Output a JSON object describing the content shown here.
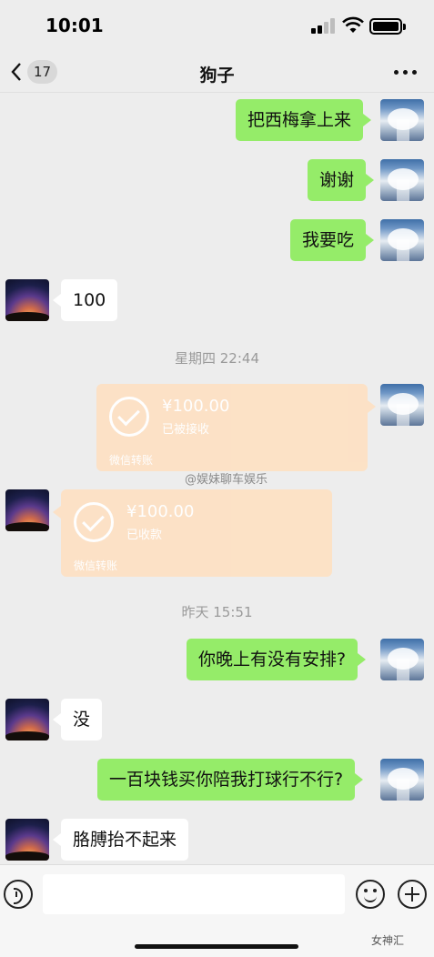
{
  "status_bar": {
    "time": "10:01"
  },
  "nav": {
    "unread_count": "17",
    "title": "狗子"
  },
  "messages": {
    "m1": "把西梅拿上来",
    "m2": "谢谢",
    "m3": "我要吃",
    "m4": "100",
    "m5": "你晚上有没有安排?",
    "m6": "没",
    "m7": "一百块钱买你陪我打球行不行?",
    "m8": "胳膊抬不起来"
  },
  "timestamps": {
    "t1": "星期四 22:44",
    "t2": "昨天 15:51"
  },
  "transfers": {
    "sent": {
      "amount": "¥100.00",
      "status": "已被接收",
      "label": "微信转账"
    },
    "received": {
      "amount": "¥100.00",
      "status": "已收款",
      "label": "微信转账"
    }
  },
  "watermark": {
    "center": "@娱妹聊车娱乐",
    "corner": "女神汇"
  },
  "icons": [
    "back-chevron-icon",
    "more-dots-icon",
    "voice-icon",
    "emoji-icon",
    "plus-icon",
    "check-circle-icon"
  ]
}
